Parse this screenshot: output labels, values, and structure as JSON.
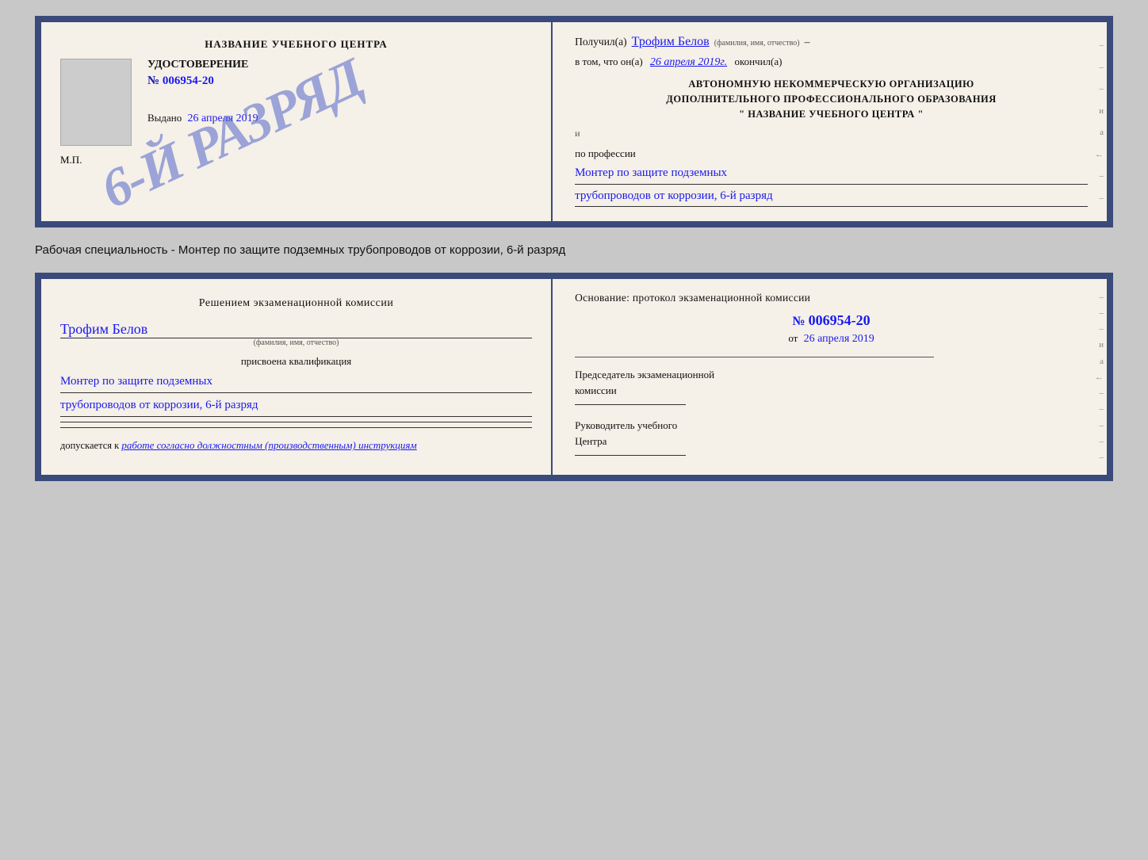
{
  "cert1": {
    "left": {
      "school_name": "НАЗВАНИЕ УЧЕБНОГО ЦЕНТРА",
      "stamp_text": "6-й разряд",
      "udostoverenie_label": "УДОСТОВЕРЕНИЕ",
      "number_prefix": "№",
      "number_value": "006954-20",
      "vydano_label": "Выдано",
      "vydano_date": "26 апреля 2019",
      "mp_label": "М.П."
    },
    "right": {
      "poluchil_label": "Получил(а)",
      "name_hw": "Трофим Белов",
      "name_sublabel": "(фамилия, имя, отчество)",
      "dash1": "–",
      "vtom_label": "в том, что он(а)",
      "date_hw": "26 апреля 2019г.",
      "okonchil_label": "окончил(а)",
      "org_line1": "АВТОНОМНУЮ НЕКОММЕРЧЕСКУЮ ОРГАНИЗАЦИЮ",
      "org_line2": "ДОПОЛНИТЕЛЬНОГО ПРОФЕССИОНАЛЬНОГО ОБРАЗОВАНИЯ",
      "org_line3": "\" НАЗВАНИЕ УЧЕБНОГО ЦЕНТРА \"",
      "i_label": "и",
      "a_label": "а",
      "arrow_label": "←",
      "po_professii_label": "по профессии",
      "profession_line1": "Монтер по защите подземных",
      "profession_line2": "трубопроводов от коррозии, 6-й разряд"
    }
  },
  "caption": {
    "text": "Рабочая специальность - Монтер по защите подземных трубопроводов от коррозии, 6-й разряд"
  },
  "doc2": {
    "left": {
      "title": "Решением экзаменационной комиссии",
      "name_hw": "Трофим Белов",
      "name_sublabel": "(фамилия, имя, отчество)",
      "prisvoena_label": "присвоена квалификация",
      "qualification_line1": "Монтер по защите подземных",
      "qualification_line2": "трубопроводов от коррозии, 6-й разряд",
      "dopuskaetsya_label": "допускается к",
      "dopuskaetsya_hw": "работе согласно должностным (производственным) инструкциям"
    },
    "right": {
      "osnovanie_label": "Основание: протокол экзаменационной комиссии",
      "number_prefix": "№",
      "number_value": "006954-20",
      "ot_label": "от",
      "ot_date_hw": "26 апреля 2019",
      "predsedatel_line1": "Председатель экзаменационной",
      "predsedatel_line2": "комиссии",
      "rukovoditel_line1": "Руководитель учебного",
      "rukovoditel_line2": "Центра",
      "side_labels": [
        "–",
        "–",
        "–",
        "и",
        "а",
        "←",
        "–",
        "–",
        "–",
        "–",
        "–"
      ]
    }
  }
}
